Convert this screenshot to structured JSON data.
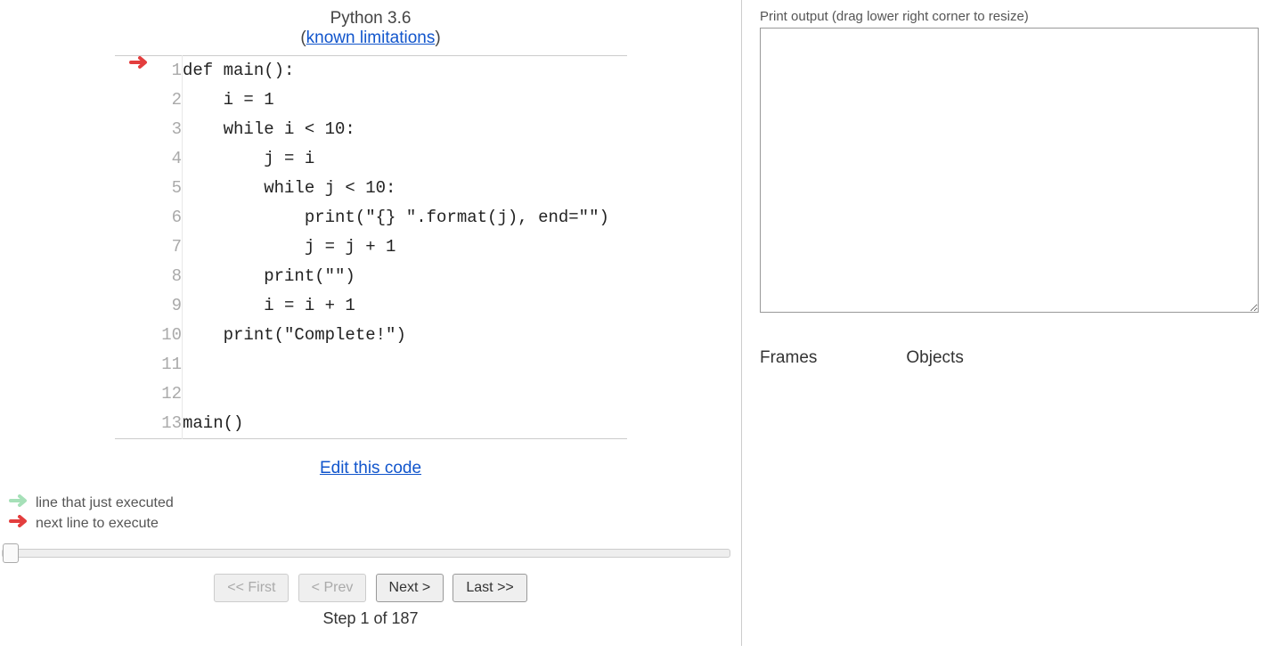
{
  "lang": {
    "name": "Python 3.6",
    "limitations_label": "known limitations"
  },
  "code": {
    "current_line": 1,
    "lines": [
      "def main():",
      "    i = 1",
      "    while i < 10:",
      "        j = i",
      "        while j < 10:",
      "            print(\"{} \".format(j), end=\"\")",
      "            j = j + 1",
      "        print(\"\")",
      "        i = i + 1",
      "    print(\"Complete!\")",
      "",
      "",
      "main()"
    ]
  },
  "edit_label": "Edit this code",
  "legend": {
    "executed": "line that just executed",
    "next": "next line to execute"
  },
  "controls": {
    "first": "<< First",
    "prev": "< Prev",
    "next": "Next >",
    "last": "Last >>",
    "first_enabled": false,
    "prev_enabled": false,
    "next_enabled": true,
    "last_enabled": true
  },
  "step": {
    "current": 1,
    "total": 187
  },
  "step_text": "Step 1 of 187",
  "slider": {
    "min": 1,
    "max": 187,
    "value": 1
  },
  "output": {
    "label": "Print output (drag lower right corner to resize)",
    "content": ""
  },
  "sections": {
    "frames": "Frames",
    "objects": "Objects"
  }
}
